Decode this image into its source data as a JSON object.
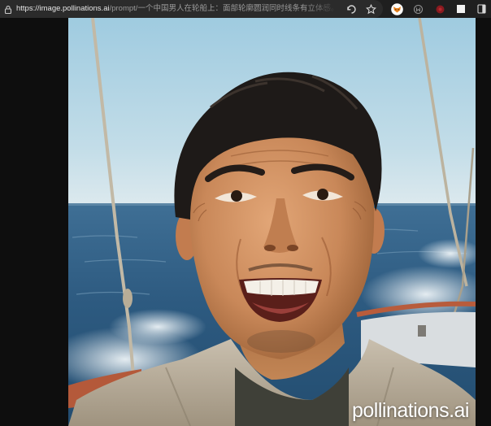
{
  "browser": {
    "url_host": "https://image.pollinations.ai",
    "url_path": "/prompt/一个中国男人在轮船上：面部轮廓圆润同时线条有立体感。笑容自然..."
  },
  "image": {
    "watermark": "pollinations.ai"
  }
}
